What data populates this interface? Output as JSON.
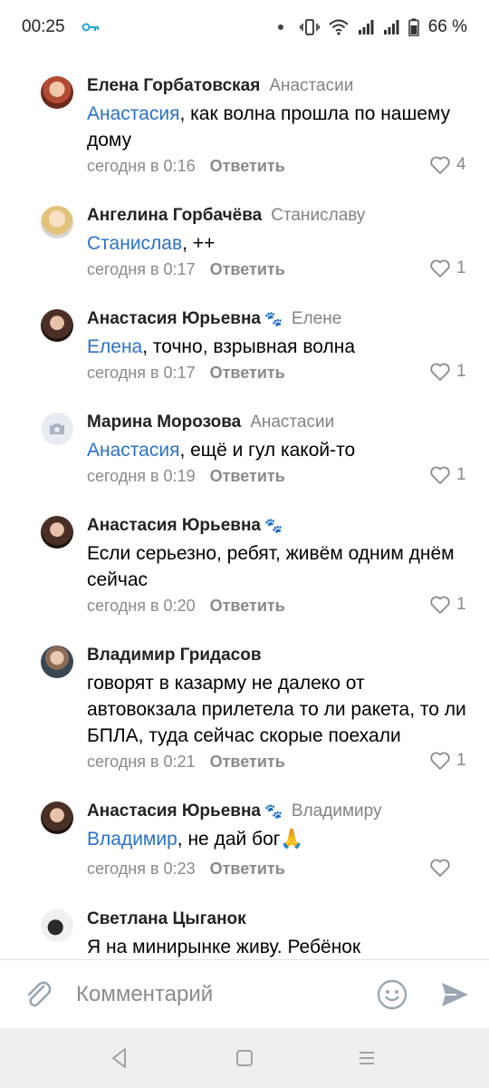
{
  "status_bar": {
    "time": "00:25",
    "battery": "66 %",
    "icons": [
      "vpn-key-icon",
      "vibrate-icon",
      "wifi-icon",
      "signal-icon",
      "signal-icon",
      "battery-icon"
    ]
  },
  "comments": [
    {
      "author": "Елена Горбатовская",
      "reply_to": "Анастасии",
      "mention": "Анастасия",
      "text": ", как волна прошла по нашему дому",
      "time": "сегодня в 0:16",
      "reply_label": "Ответить",
      "likes": "4"
    },
    {
      "author": "Ангелина Горбачёва",
      "reply_to": "Станиславу",
      "mention": "Станислав",
      "text": ", ++",
      "time": "сегодня в 0:17",
      "reply_label": "Ответить",
      "likes": "1"
    },
    {
      "author": "Анастасия Юрьевна",
      "badge": "🐾",
      "reply_to": "Елене",
      "mention": "Елена",
      "text": ", точно, взрывная волна",
      "time": "сегодня в 0:17",
      "reply_label": "Ответить",
      "likes": "1"
    },
    {
      "author": "Марина Морозова",
      "reply_to": "Анастасии",
      "mention": "Анастасия",
      "text": ", ещё и гул какой-то",
      "time": "сегодня в 0:19",
      "reply_label": "Ответить",
      "likes": "1"
    },
    {
      "author": "Анастасия Юрьевна",
      "badge": "🐾",
      "text": "Если серьезно, ребят, живём одним днём сейчас",
      "time": "сегодня в 0:20",
      "reply_label": "Ответить",
      "likes": "1"
    },
    {
      "author": "Владимир Гридасов",
      "text": "говорят в казарму не далеко от автовокзала прилетела то ли ракета, то ли БПЛА, туда сейчас скорые поехали",
      "time": "сегодня в 0:21",
      "reply_label": "Ответить",
      "likes": "1"
    },
    {
      "author": "Анастасия Юрьевна",
      "badge": "🐾",
      "reply_to": "Владимиру",
      "mention": "Владимир",
      "text": ", не дай бог🙏",
      "time": "сегодня в 0:23",
      "reply_label": "Ответить",
      "likes": ""
    },
    {
      "author": "Светлана Цыганок",
      "text": "Я на минирынке живу. Ребёнок"
    }
  ],
  "composer": {
    "placeholder": "Комментарий"
  },
  "colors": {
    "mention": "#2a72c8",
    "secondary_text": "#8a8a8a",
    "send_icon": "#9aa6b2",
    "nav_background": "#efeff1"
  }
}
